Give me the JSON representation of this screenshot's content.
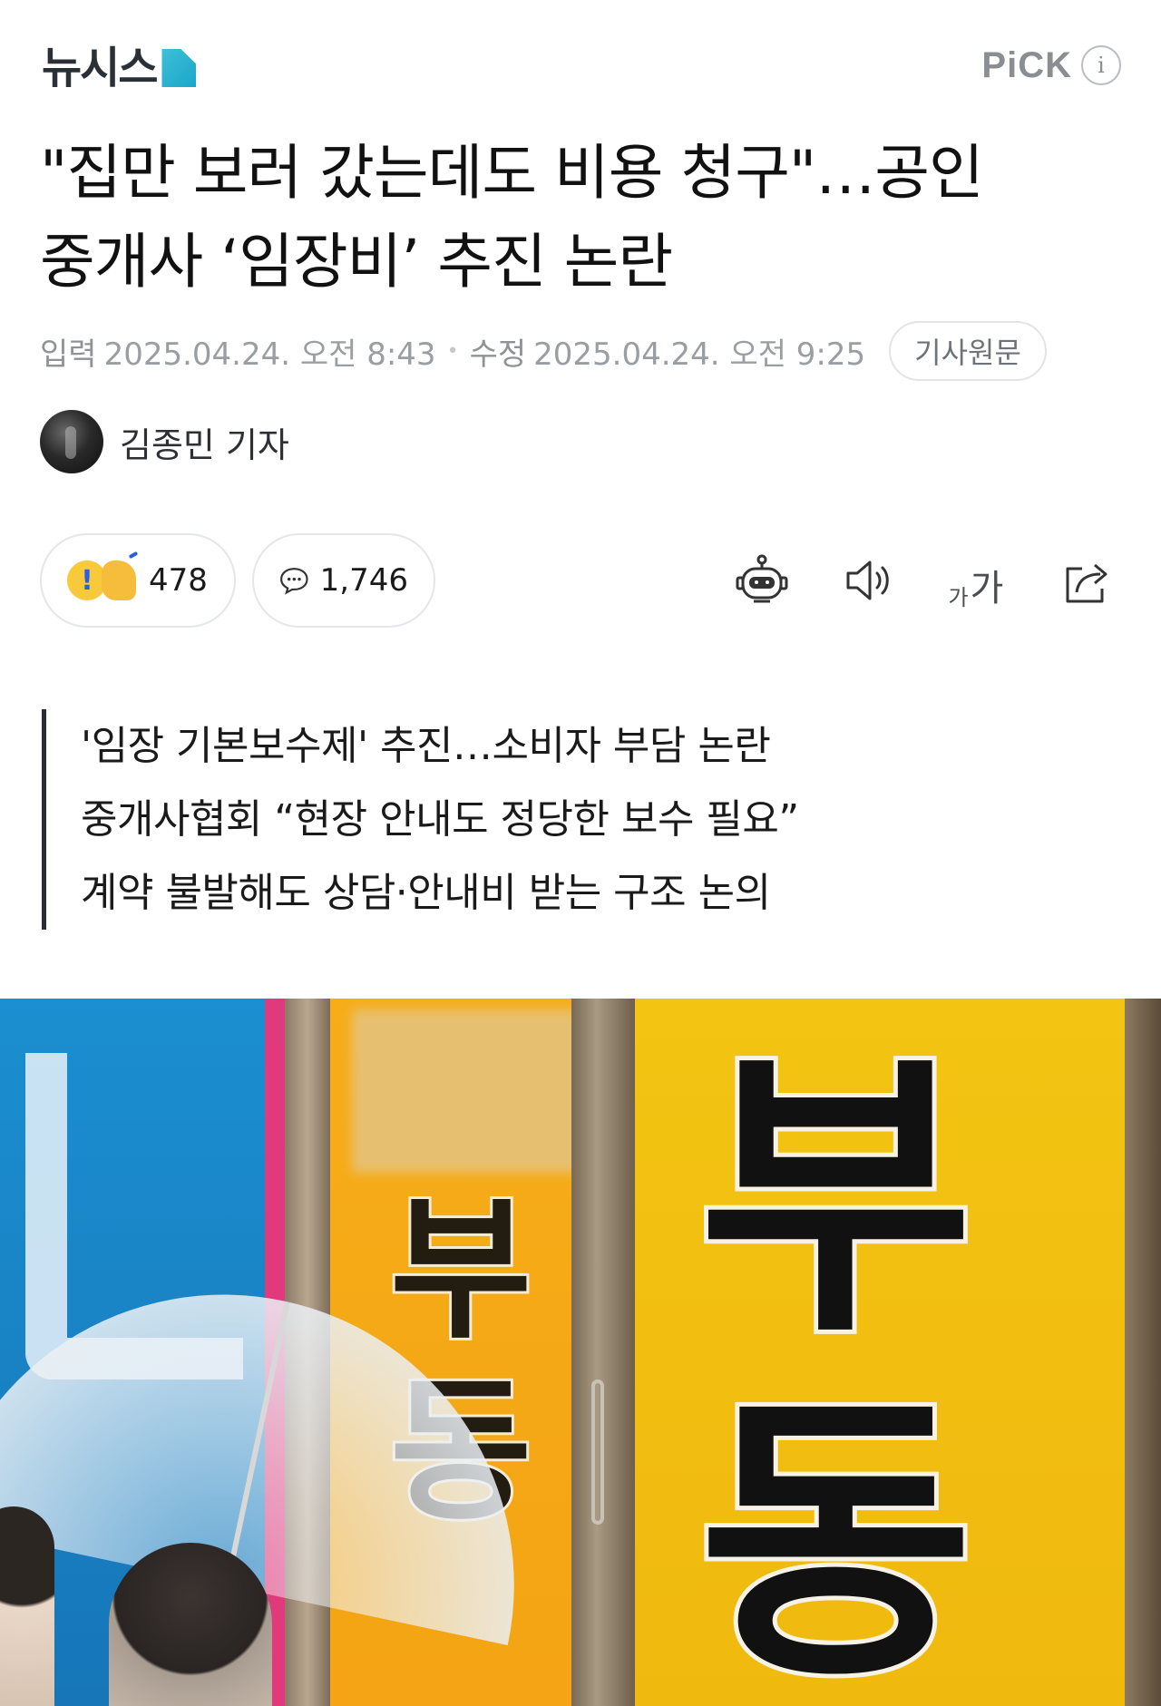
{
  "header": {
    "logo_text": "뉴시스",
    "pick_label": "PiCK",
    "info_label": "i"
  },
  "article": {
    "title_line1": "\"집만 보러 갔는데도 비용 청구\"…공인",
    "title_line2": "중개사 ‘임장비’ 추진 논란",
    "published_label": "입력",
    "published_value": "2025.04.24. 오전 8:43",
    "modified_label": "수정",
    "modified_value": "2025.04.24. 오전 9:25",
    "original_button": "기사원문",
    "reporter": "김종민 기자"
  },
  "actions": {
    "reaction_count": "478",
    "comment_count": "1,746",
    "font_small": "가",
    "font_large": "가"
  },
  "summary": [
    "'임장 기본보수제' 추진…소비자 부담 논란",
    "중개사협회 “현장 안내도 정당한 보수 필요”",
    "계약 불발해도 상담·안내비 받는 구조 논의"
  ],
  "photo": {
    "sign_big_1": "부",
    "sign_big_2": "동",
    "sign_small_1": "부",
    "sign_small_2": "동"
  },
  "colors": {
    "logo_accent": "#1aa6c7",
    "text_primary": "#111111",
    "text_meta": "#8f9296",
    "border": "#e4e6e9"
  },
  "icons": [
    "info-icon",
    "reaction-emoji-icon",
    "comment-bubble-icon",
    "ai-summary-bot-icon",
    "speaker-icon",
    "font-size-icon",
    "share-icon"
  ]
}
